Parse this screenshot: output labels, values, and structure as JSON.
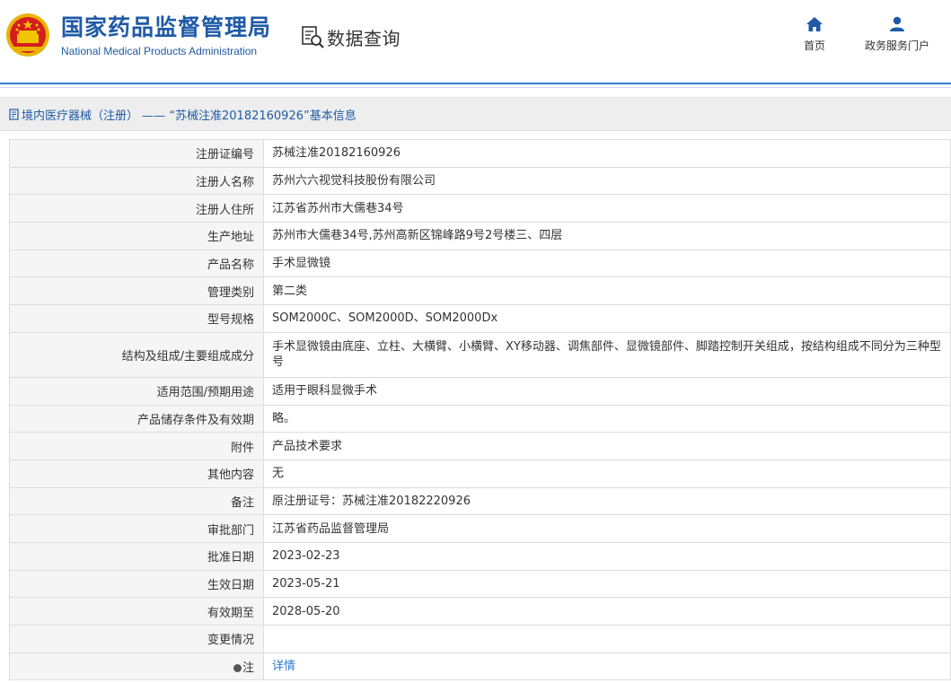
{
  "header": {
    "agency_cn": "国家药品监督管理局",
    "agency_en": "National Medical Products Administration",
    "query_label": "数据查询",
    "nav": [
      {
        "label": "首页",
        "icon": "home-icon"
      },
      {
        "label": "政务服务门户",
        "icon": "user-icon"
      }
    ]
  },
  "breadcrumb": {
    "text": "境内医疗器械（注册） —— “苏械注准20182160926”基本信息",
    "icon": "document-icon"
  },
  "colors": {
    "brand_blue": "#1f5aa6",
    "rule_blue": "#2e7fd3",
    "link_blue": "#2a7ad5",
    "label_bg": "#f5f5f5"
  },
  "rows": [
    {
      "label": "注册证编号",
      "value": "苏械注准20182160926"
    },
    {
      "label": "注册人名称",
      "value": "苏州六六视觉科技股份有限公司"
    },
    {
      "label": "注册人住所",
      "value": "江苏省苏州市大儒巷34号"
    },
    {
      "label": "生产地址",
      "value": "苏州市大儒巷34号,苏州高新区锦峰路9号2号楼三、四层"
    },
    {
      "label": "产品名称",
      "value": "手术显微镜"
    },
    {
      "label": "管理类别",
      "value": "第二类"
    },
    {
      "label": "型号规格",
      "value": "SOM2000C、SOM2000D、SOM2000Dx"
    },
    {
      "label": "结构及组成/主要组成成分",
      "value": "手术显微镜由底座、立柱、大横臂、小横臂、XY移动器、调焦部件、显微镜部件、脚踏控制开关组成，按结构组成不同分为三种型号"
    },
    {
      "label": "适用范围/预期用途",
      "value": "适用于眼科显微手术"
    },
    {
      "label": "产品储存条件及有效期",
      "value": "略。"
    },
    {
      "label": "附件",
      "value": "产品技术要求"
    },
    {
      "label": "其他内容",
      "value": "无"
    },
    {
      "label": "备注",
      "value": "原注册证号：苏械注准20182220926"
    },
    {
      "label": "审批部门",
      "value": "江苏省药品监督管理局"
    },
    {
      "label": "批准日期",
      "value": "2023-02-23"
    },
    {
      "label": "生效日期",
      "value": "2023-05-21"
    },
    {
      "label": "有效期至",
      "value": "2028-05-20"
    },
    {
      "label": "变更情况",
      "value": ""
    },
    {
      "label": "注",
      "value": "详情"
    }
  ]
}
